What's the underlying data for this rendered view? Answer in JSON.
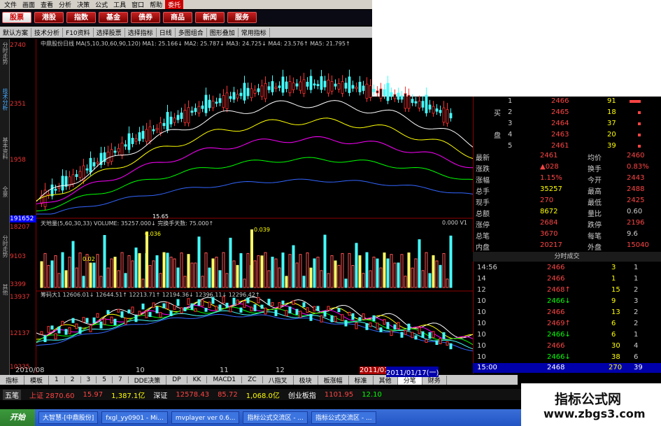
{
  "menu": [
    "文件",
    "画面",
    "查看",
    "分析",
    "决策",
    "公式",
    "工具",
    "窗口",
    "帮助",
    "委托"
  ],
  "nav": [
    "股票",
    "港股",
    "指数",
    "基金",
    "债券",
    "商品",
    "新闻",
    "服务"
  ],
  "toolbar": [
    "默认方案",
    "技术分析",
    "F10资料",
    "选择股票",
    "选择指标",
    "日线",
    "多图组合",
    "图形叠加",
    "常用指标"
  ],
  "left_tabs": [
    "分时走势",
    "技术分析",
    "基本资料",
    "全景",
    "分时走势",
    "其他"
  ],
  "price_axis": {
    "labels": [
      "2740",
      "2351",
      "1958",
      "191652",
      "18207",
      "9103",
      "3399",
      "13937",
      "12137",
      "10335"
    ]
  },
  "main_ind": {
    "line": "中鼎股份日线 MA(5,10,30,60,90,120) MA1: 25.166↓ MA2: 25.787↓ MA3: 24.725↓ MA4: 23.576↑ MA5: 21.795↑",
    "low_mark": "15.65"
  },
  "vol_ind": {
    "line": "天地量(5,60,30,33) VOLUME: 35257.000↓ 完换手天数: 75.000↑",
    "right": "0.000 V1",
    "peak1": "0.036",
    "peak2": "0.039",
    "small": "0.02"
  },
  "third_ind": {
    "line": "筹码大1 12606.01↓ 12644.51↑ 12213.71↑ 12194.36↓ 12396.11↓ 12296.42↑"
  },
  "orderbook": {
    "sell": [
      {
        "n": "1",
        "p": "2466",
        "v": "91"
      },
      {
        "n": "2",
        "p": "2465",
        "v": "18"
      },
      {
        "n": "3",
        "p": "2464",
        "v": "37"
      },
      {
        "n": "4",
        "p": "2463",
        "v": "20"
      },
      {
        "n": "5",
        "p": "2461",
        "v": "39"
      }
    ],
    "buy_label": "买",
    "sell_label": "盘"
  },
  "quote": [
    [
      "最新",
      "2461",
      "均价",
      "2460"
    ],
    [
      "涨跌",
      "▲028",
      "换手",
      "0.83%"
    ],
    [
      "涨幅",
      "1.15%",
      "今开",
      "2443"
    ],
    [
      "总手",
      "35257",
      "最高",
      "2488"
    ],
    [
      "现手",
      "270",
      "最低",
      "2425"
    ],
    [
      "总额",
      "8672",
      "量比",
      "0.60"
    ],
    [
      "涨停",
      "2684",
      "跌停",
      "2196"
    ],
    [
      "总笔",
      "3670",
      "每笔",
      "9.6"
    ],
    [
      "内盘",
      "20217",
      "外盘",
      "15040"
    ]
  ],
  "ticks_header": "分时成交",
  "ticks": [
    [
      "14:56",
      "2466",
      "3",
      "1"
    ],
    [
      "14",
      "2466",
      "1",
      "1"
    ],
    [
      "12",
      "2468↑",
      "15",
      "2"
    ],
    [
      "10",
      "2466↓",
      "9",
      "3"
    ],
    [
      "10",
      "2466",
      "13",
      "2"
    ],
    [
      "10",
      "2469↑",
      "6",
      "2"
    ],
    [
      "10",
      "2466↓",
      "6",
      "1"
    ],
    [
      "10",
      "2466",
      "30",
      "4"
    ],
    [
      "10",
      "2466↓",
      "38",
      "6"
    ]
  ],
  "ticks_last": [
    "15:00",
    "2468",
    "270",
    "39"
  ],
  "bottom_tabs": [
    "指标",
    "模板",
    "1",
    "2",
    "3",
    "5",
    "7",
    "DDE决策",
    "DP",
    "KK",
    "MACD1",
    "ZC",
    "八指叉",
    "极块",
    "板涨幅",
    "标准",
    "其他",
    "分笔",
    "财务"
  ],
  "dates": [
    "2010/08",
    "10",
    "11",
    "12",
    "2011/01",
    "2011/01/17(一)"
  ],
  "ticker": [
    "上证 2870.60",
    "15.97",
    "1,387.1亿",
    "深证",
    "12578.43",
    "85.72",
    "1,068.0亿",
    "创业板指",
    "1101.95",
    "12.10"
  ],
  "taskbar": [
    "开始",
    "大智慧-[中鼎股份]",
    "fxgl_yy0901 - Mi...",
    "mvplayer ver 0.6...",
    "指标公式交流区 - ...",
    "指标公式交流区 - ..."
  ],
  "watermark": {
    "t1": "指标公式网",
    "t2": "www.zbgs3.com"
  },
  "app_title": "五笔"
}
